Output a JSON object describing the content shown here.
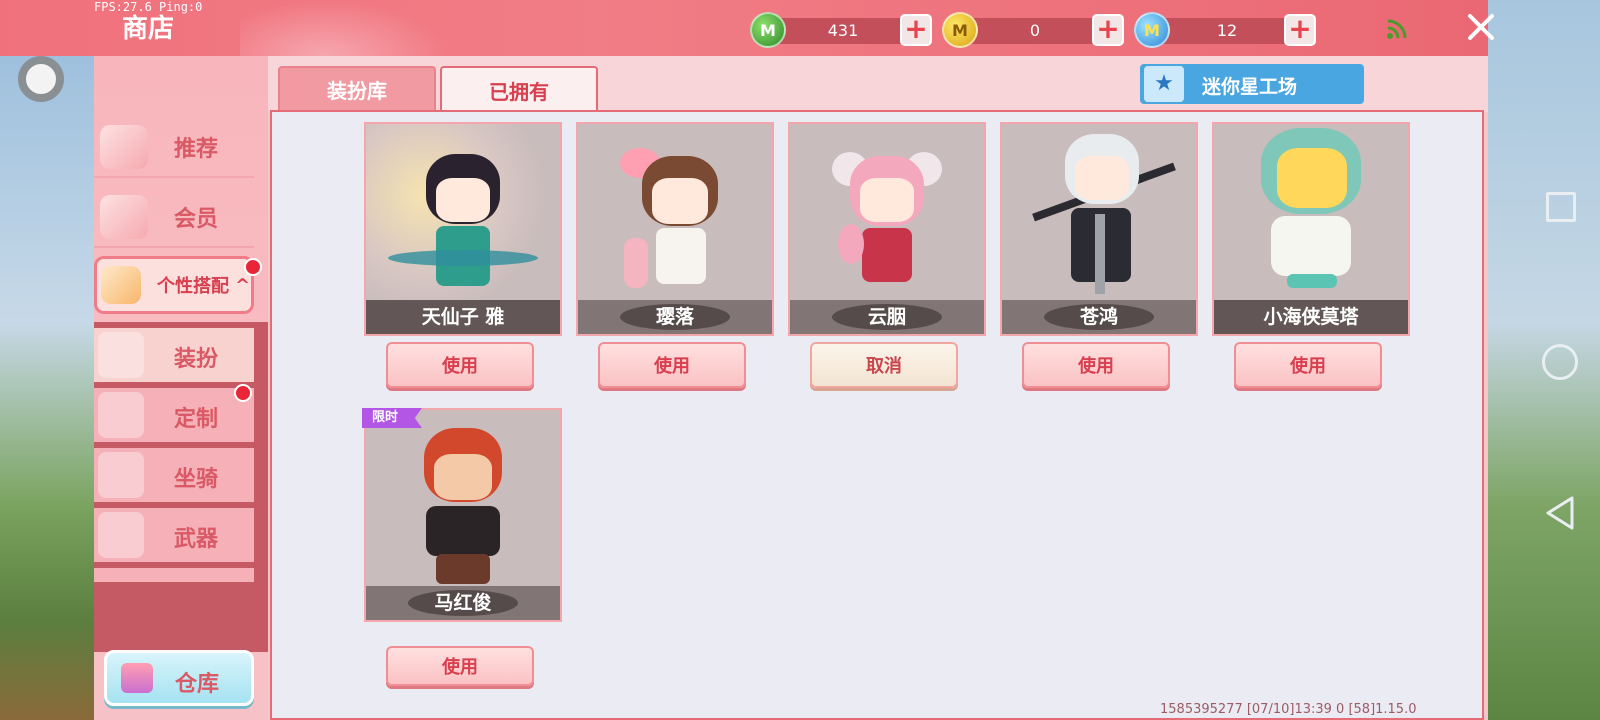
{
  "debug": {
    "fps_text": "FPS:27.6 Ping:0"
  },
  "header": {
    "title": "商店",
    "currencies": [
      {
        "icon": "green-gem-icon",
        "letter": "M",
        "value": "431"
      },
      {
        "icon": "gold-coin-icon",
        "letter": "M",
        "value": "0"
      },
      {
        "icon": "blue-coin-icon",
        "letter": "M",
        "value": "12"
      }
    ],
    "plus_label": "+"
  },
  "sidebar": {
    "items": [
      {
        "label": "推荐",
        "icon": "thumbs-up-icon"
      },
      {
        "label": "会员",
        "icon": "vip-icon"
      },
      {
        "label": "个性搭配",
        "icon": "fashion-icon",
        "chevron": "^"
      }
    ],
    "sub_items": [
      {
        "label": "装扮",
        "icon": "shirt-icon"
      },
      {
        "label": "定制",
        "icon": "brush-icon"
      },
      {
        "label": "坐骑",
        "icon": "mount-icon"
      },
      {
        "label": "武器",
        "icon": "gun-icon"
      }
    ],
    "warehouse_label": "仓库"
  },
  "tabs": [
    {
      "label": "装扮库",
      "active": false
    },
    {
      "label": "已拥有",
      "active": true
    }
  ],
  "workshop": {
    "label": "迷你星工场",
    "icon": "star-icon"
  },
  "skins": [
    {
      "name": "天仙子 雅",
      "action": "使用",
      "limited": false
    },
    {
      "name": "璎落",
      "action": "使用",
      "limited": false
    },
    {
      "name": "云胭",
      "action": "取消",
      "limited": false
    },
    {
      "name": "苍鸿",
      "action": "使用",
      "limited": false
    },
    {
      "name": "小海侠莫塔",
      "action": "使用",
      "limited": false
    },
    {
      "name": "马红俊",
      "action": "使用",
      "limited": true,
      "badge": "限时"
    }
  ],
  "footer": {
    "info": "1585395277  [07/10]13:39 0  [58]1.15.0"
  },
  "colors": {
    "brand_pink": "#f0717c",
    "accent_red": "#d9404f",
    "button_blue": "#4aa6e0"
  }
}
